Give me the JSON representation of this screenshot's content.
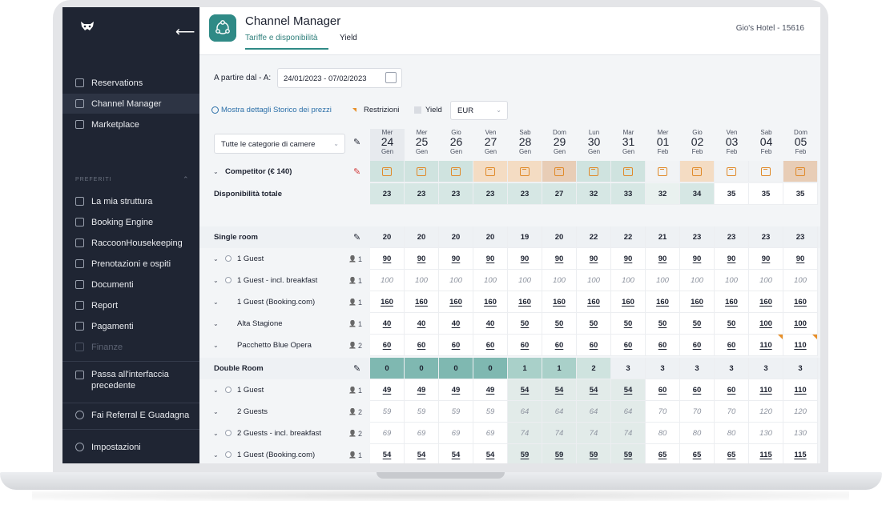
{
  "sidebar": {
    "collapse_icon": "arrow-left-icon",
    "main_items": [
      {
        "label": "Reservations",
        "icon": "calendar-icon",
        "active": false
      },
      {
        "label": "Channel Manager",
        "icon": "network-icon",
        "active": true
      },
      {
        "label": "Marketplace",
        "icon": "grid-icon",
        "active": false
      }
    ],
    "section_title": "PREFERITI",
    "fav_items": [
      {
        "label": "La mia struttura",
        "icon": "building-icon",
        "disabled": false
      },
      {
        "label": "Booking Engine",
        "icon": "booking-icon",
        "disabled": false
      },
      {
        "label": "RaccoonHousekeeping",
        "icon": "broom-icon",
        "disabled": false
      },
      {
        "label": "Prenotazioni e ospiti",
        "icon": "users-icon",
        "disabled": false
      },
      {
        "label": "Documenti",
        "icon": "document-icon",
        "disabled": false
      },
      {
        "label": "Report",
        "icon": "chart-icon",
        "disabled": false
      },
      {
        "label": "Pagamenti",
        "icon": "wallet-icon",
        "disabled": false
      },
      {
        "label": "Finanze",
        "icon": "finance-icon",
        "disabled": true
      }
    ],
    "switch_label": "Passa all'interfaccia precedente",
    "referral_label": "Fai Referral E Guadagna",
    "settings_label": "Impostazioni"
  },
  "header": {
    "title": "Channel Manager",
    "tabs": [
      {
        "label": "Tariffe e disponibilità",
        "active": true
      },
      {
        "label": "Yield",
        "active": false
      }
    ],
    "hotel": "Gio's Hotel - 15616"
  },
  "filters": {
    "date_label": "A partire dal - A:",
    "date_range": "24/01/2023 - 07/02/2023",
    "history_link": "Mostra dettagli Storico dei prezzi",
    "restrictions_label": "Restrizioni",
    "yield_label": "Yield",
    "currency": "EUR",
    "category": "Tutte le categorie di camere"
  },
  "days": [
    {
      "name": "Mer",
      "num": "24",
      "month": "Gen"
    },
    {
      "name": "Mer",
      "num": "25",
      "month": "Gen"
    },
    {
      "name": "Gio",
      "num": "26",
      "month": "Gen"
    },
    {
      "name": "Ven",
      "num": "27",
      "month": "Gen"
    },
    {
      "name": "Sab",
      "num": "28",
      "month": "Gen"
    },
    {
      "name": "Dom",
      "num": "29",
      "month": "Gen"
    },
    {
      "name": "Lun",
      "num": "30",
      "month": "Gen"
    },
    {
      "name": "Mar",
      "num": "31",
      "month": "Gen"
    },
    {
      "name": "Mer",
      "num": "01",
      "month": "Feb"
    },
    {
      "name": "Gio",
      "num": "02",
      "month": "Feb"
    },
    {
      "name": "Ven",
      "num": "03",
      "month": "Feb"
    },
    {
      "name": "Sab",
      "num": "04",
      "month": "Feb"
    },
    {
      "name": "Dom",
      "num": "05",
      "month": "Feb"
    }
  ],
  "competitor": {
    "label": "Competitor (€ 140)"
  },
  "availability": {
    "label": "Disponibilità totale",
    "values": [
      "23",
      "23",
      "23",
      "23",
      "23",
      "27",
      "32",
      "33",
      "32",
      "34",
      "35",
      "35",
      "35"
    ]
  },
  "rooms": [
    {
      "name": "Single room",
      "availability": [
        "20",
        "20",
        "20",
        "20",
        "19",
        "20",
        "22",
        "22",
        "21",
        "23",
        "23",
        "23",
        "23"
      ],
      "rates": [
        {
          "label": "1 Guest",
          "occupancy": "1",
          "style": "u",
          "values": [
            "90",
            "90",
            "90",
            "90",
            "90",
            "90",
            "90",
            "90",
            "90",
            "90",
            "90",
            "90",
            "90"
          ]
        },
        {
          "label": "1 Guest - incl. breakfast",
          "occupancy": "1",
          "style": "i",
          "values": [
            "100",
            "100",
            "100",
            "100",
            "100",
            "100",
            "100",
            "100",
            "100",
            "100",
            "100",
            "100",
            "100"
          ]
        },
        {
          "label": "1 Guest (Booking.com)",
          "occupancy": "1",
          "style": "u",
          "values": [
            "160",
            "160",
            "160",
            "160",
            "160",
            "160",
            "160",
            "160",
            "160",
            "160",
            "160",
            "160",
            "160"
          ]
        },
        {
          "label": "Alta Stagione",
          "occupancy": "1",
          "style": "u",
          "values": [
            "40",
            "40",
            "40",
            "40",
            "50",
            "50",
            "50",
            "50",
            "50",
            "50",
            "50",
            "100",
            "100"
          ]
        },
        {
          "label": "Pacchetto Blue Opera",
          "occupancy": "2",
          "style": "u",
          "values": [
            "60",
            "60",
            "60",
            "60",
            "60",
            "60",
            "60",
            "60",
            "60",
            "60",
            "60",
            "110",
            "110"
          ]
        }
      ]
    },
    {
      "name": "Double Room",
      "availability": [
        "0",
        "0",
        "0",
        "0",
        "1",
        "1",
        "2",
        "3",
        "3",
        "3",
        "3",
        "3",
        "3"
      ],
      "rates": [
        {
          "label": "1 Guest",
          "occupancy": "1",
          "style": "u",
          "values": [
            "49",
            "49",
            "49",
            "49",
            "54",
            "54",
            "54",
            "54",
            "60",
            "60",
            "60",
            "110",
            "110"
          ]
        },
        {
          "label": "2 Guests",
          "occupancy": "2",
          "style": "i",
          "values": [
            "59",
            "59",
            "59",
            "59",
            "64",
            "64",
            "64",
            "64",
            "70",
            "70",
            "70",
            "120",
            "120"
          ]
        },
        {
          "label": "2 Guests - incl. breakfast",
          "occupancy": "2",
          "style": "i",
          "values": [
            "69",
            "69",
            "69",
            "69",
            "74",
            "74",
            "74",
            "74",
            "80",
            "80",
            "80",
            "130",
            "130"
          ]
        },
        {
          "label": "1 Guest (Booking.com)",
          "occupancy": "1",
          "style": "u",
          "values": [
            "54",
            "54",
            "54",
            "54",
            "59",
            "59",
            "59",
            "59",
            "65",
            "65",
            "65",
            "115",
            "115"
          ]
        }
      ]
    }
  ],
  "colors": {
    "accent": "#2f8a86",
    "sidebar_bg": "#1f2533",
    "restriction": "#e8902a",
    "sold_out": "#7fb8b1",
    "low_avail": "#cfe3df"
  }
}
